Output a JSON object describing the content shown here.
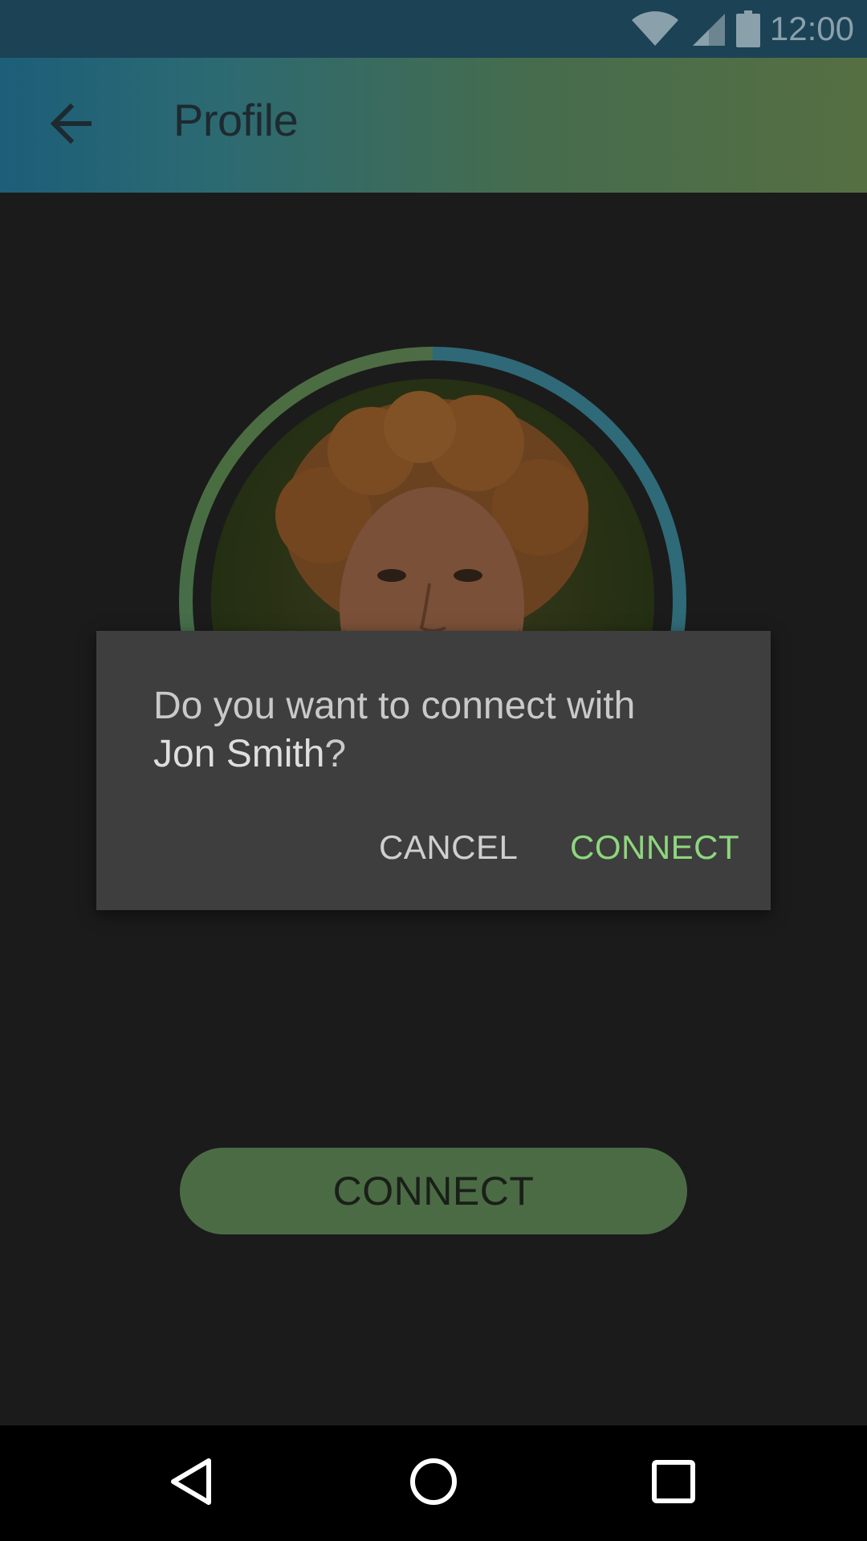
{
  "status_bar": {
    "time": "12:00",
    "icons": [
      "wifi-icon",
      "signal-icon",
      "battery-icon"
    ]
  },
  "app_bar": {
    "title": "Profile",
    "back_icon": "arrow-back-icon"
  },
  "dialog": {
    "message_prefix": "Do you want to connect with",
    "name": "Jon Smith",
    "message_suffix": "?",
    "cancel_label": "CANCEL",
    "connect_label": "CONNECT",
    "accent_color": "#8ed67e"
  },
  "main": {
    "connect_label": "CONNECT"
  },
  "nav_bar": {
    "icons": [
      "back-triangle-icon",
      "home-circle-icon",
      "recents-square-icon"
    ]
  },
  "colors": {
    "status_bar": "#1b4255",
    "app_bar_start": "#1d5e79",
    "app_bar_end": "#566f42",
    "background": "#1b1b1b",
    "dialog_bg": "#3e3e3e",
    "button_bg": "#4b6b45"
  }
}
